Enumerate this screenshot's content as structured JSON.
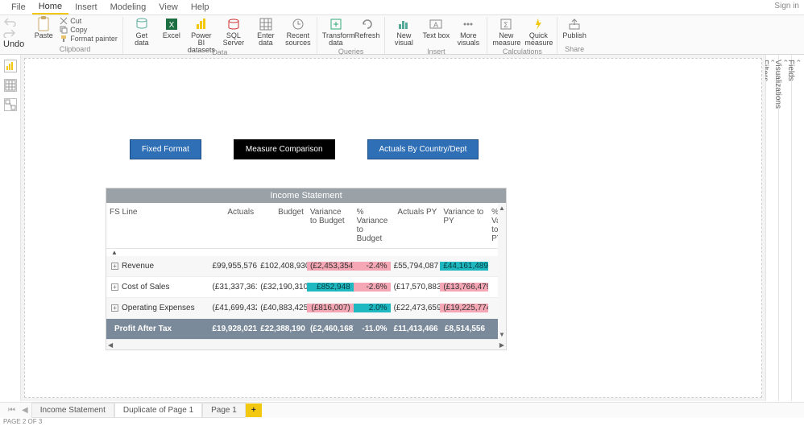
{
  "app": {
    "signin": "Sign in"
  },
  "menu": {
    "items": [
      "File",
      "Home",
      "Insert",
      "Modeling",
      "View",
      "Help"
    ],
    "active": 1
  },
  "ribbon": {
    "undo_label": "Undo",
    "clipboard": {
      "paste": "Paste",
      "cut": "Cut",
      "copy": "Copy",
      "format_painter": "Format painter",
      "group": "Clipboard"
    },
    "data": {
      "getdata": "Get\ndata",
      "excel": "Excel",
      "pbids": "Power BI\ndatasets",
      "sql": "SQL\nServer",
      "enter": "Enter\ndata",
      "recent": "Recent\nsources",
      "group": "Data"
    },
    "queries": {
      "transform": "Transform\ndata",
      "refresh": "Refresh",
      "group": "Queries"
    },
    "insert": {
      "newvisual": "New\nvisual",
      "textbox": "Text\nbox",
      "more": "More\nvisuals",
      "group": "Insert"
    },
    "calc": {
      "newmeasure": "New\nmeasure",
      "quick": "Quick\nmeasure",
      "group": "Calculations"
    },
    "share": {
      "publish": "Publish",
      "group": "Share"
    }
  },
  "nav_buttons": [
    {
      "label": "Fixed Format",
      "style": "blue"
    },
    {
      "label": "Measure Comparison",
      "style": "black"
    },
    {
      "label": "Actuals By Country/Dept",
      "style": "blue"
    }
  ],
  "table": {
    "title": "Income Statement",
    "columns": [
      "FS Line",
      "Actuals",
      "Budget",
      "Variance to Budget",
      "% Variance to Budget",
      "Actuals PY",
      "Variance to PY",
      "% Variance to PY"
    ],
    "rows": [
      {
        "label": "Revenue",
        "actuals": "£99,955,576",
        "budget": "£102,408,930",
        "var_b": "(£2,453,354)",
        "var_b_hl": "pink",
        "pct_b": "-2.4%",
        "pct_b_hl": "pink",
        "actuals_py": "£55,794,087",
        "var_py": "£44,161,489",
        "var_py_hl": "teal"
      },
      {
        "label": "Cost of Sales",
        "actuals": "(£31,337,361)",
        "budget": "(£32,190,310)",
        "var_b": "£852,948",
        "var_b_hl": "teal",
        "pct_b": "-2.6%",
        "pct_b_hl": "pink",
        "actuals_py": "(£17,570,883)",
        "var_py": "(£13,766,479)",
        "var_py_hl": "pink"
      },
      {
        "label": "Operating Expenses",
        "actuals": "(£41,699,432)",
        "budget": "(£40,883,425)",
        "var_b": "(£816,007)",
        "var_b_hl": "pink",
        "pct_b": "2.0%",
        "pct_b_hl": "teal",
        "actuals_py": "(£22,473,659)",
        "var_py": "(£19,225,774)",
        "var_py_hl": "pink"
      }
    ],
    "total": {
      "label": "Profit After Tax",
      "actuals": "£19,928,021",
      "budget": "£22,388,190",
      "var_b": "(£2,460,168)",
      "pct_b": "-11.0%",
      "actuals_py": "£11,413,466",
      "var_py": "£8,514,556"
    }
  },
  "rails": {
    "filters": "Filters",
    "viz": "Visualizations",
    "fields": "Fields"
  },
  "pages": {
    "tabs": [
      "Income Statement",
      "Duplicate of Page 1",
      "Page 1"
    ],
    "active": 1
  },
  "status": "PAGE 2 OF 3",
  "colors": {
    "accent": "#f2c811",
    "blue": "#2f6fb5",
    "teal": "#1fb8c0",
    "pink": "#f5a7b5",
    "totalbg": "#7b8a9a"
  }
}
